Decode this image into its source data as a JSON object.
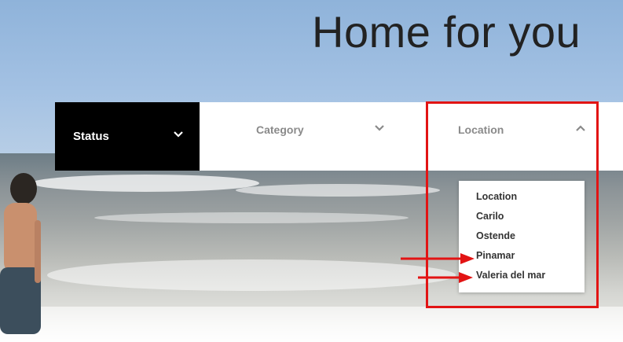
{
  "page": {
    "title": "Home for you"
  },
  "filters": {
    "status": {
      "label": "Status",
      "state": "collapsed"
    },
    "category": {
      "label": "Category",
      "state": "collapsed"
    },
    "location": {
      "label": "Location",
      "state": "expanded"
    }
  },
  "location_dropdown": {
    "options": [
      "Location",
      "Carilo",
      "Ostende",
      "Pinamar",
      "Valeria del mar"
    ]
  },
  "annotation": {
    "color": "#e21414",
    "pointed_options": [
      "Pinamar",
      "Valeria del mar"
    ]
  },
  "icons": {
    "status_chevron": "chevron-down-icon",
    "category_chevron": "chevron-down-icon",
    "location_chevron": "chevron-up-icon"
  }
}
